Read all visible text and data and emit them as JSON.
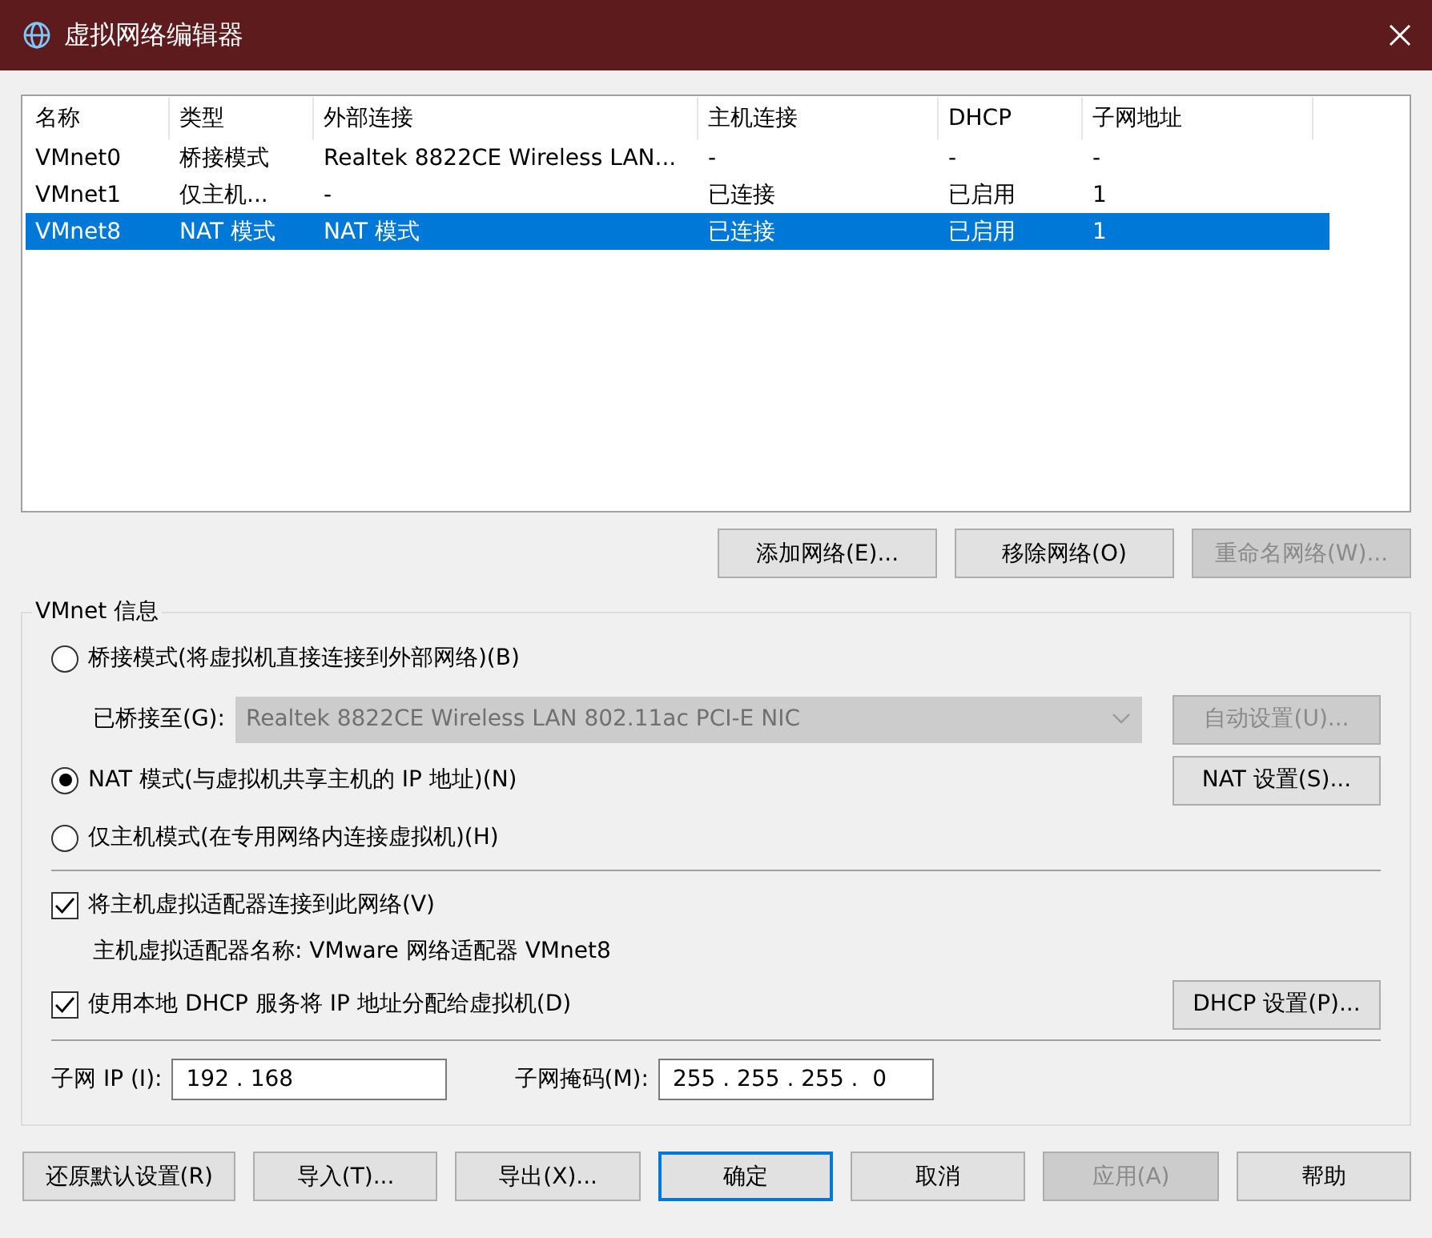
{
  "window": {
    "title": "虚拟网络编辑器"
  },
  "table": {
    "columns": [
      "名称",
      "类型",
      "外部连接",
      "主机连接",
      "DHCP",
      "子网地址"
    ],
    "rows": [
      {
        "cells": [
          "VMnet0",
          "桥接模式",
          "Realtek 8822CE Wireless LAN...",
          "-",
          "-",
          "-"
        ],
        "selected": false
      },
      {
        "cells": [
          "VMnet1",
          "仅主机...",
          "-",
          "已连接",
          "已启用",
          "1"
        ],
        "selected": false
      },
      {
        "cells": [
          "VMnet8",
          "NAT 模式",
          "NAT 模式",
          "已连接",
          "已启用",
          "1"
        ],
        "selected": true
      }
    ]
  },
  "network_buttons": [
    {
      "label": "添加网络(E)...",
      "disabled": false
    },
    {
      "label": "移除网络(O)",
      "disabled": false
    },
    {
      "label": "重命名网络(W)...",
      "disabled": true
    }
  ],
  "info": {
    "title": "VMnet 信息",
    "modes": [
      {
        "kind": "bridged",
        "label": "桥接模式(将虚拟机直接连接到外部网络)(B)",
        "selected": false,
        "bridge_to": {
          "label": "已桥接至(G):",
          "value": "Realtek 8822CE Wireless LAN 802.11ac PCI-E NIC",
          "disabled": true,
          "button": {
            "label": "自动设置(U)...",
            "disabled": true
          }
        }
      },
      {
        "kind": "nat",
        "label": "NAT 模式(与虚拟机共享主机的 IP 地址)(N)",
        "selected": true,
        "button": {
          "label": "NAT 设置(S)...",
          "disabled": false
        }
      },
      {
        "kind": "host_only",
        "label": "仅主机模式(在专用网络内连接虚拟机)(H)",
        "selected": false
      }
    ],
    "connect_adapter": {
      "label": "将主机虚拟适配器连接到此网络(V)",
      "checked": true
    },
    "adapter_name": "主机虚拟适配器名称: VMware 网络适配器 VMnet8",
    "dhcp": {
      "label": "使用本地 DHCP 服务将 IP 地址分配给虚拟机(D)",
      "checked": true,
      "button": {
        "label": "DHCP 设置(P)...",
        "disabled": false
      }
    },
    "subnet_ip": {
      "label": "子网 IP (I):",
      "value": "192 . 168"
    },
    "subnet_mask": {
      "label": "子网掩码(M):",
      "value": "255 . 255 . 255 .  0"
    }
  },
  "footer_buttons": [
    {
      "label": "还原默认设置(R)",
      "disabled": false,
      "default": false
    },
    {
      "label": "导入(T)...",
      "disabled": false,
      "default": false
    },
    {
      "label": "导出(X)...",
      "disabled": false,
      "default": false
    },
    {
      "label": "确定",
      "disabled": false,
      "default": true
    },
    {
      "label": "取消",
      "disabled": false,
      "default": false
    },
    {
      "label": "应用(A)",
      "disabled": true,
      "default": false
    },
    {
      "label": "帮助",
      "disabled": false,
      "default": false
    }
  ]
}
